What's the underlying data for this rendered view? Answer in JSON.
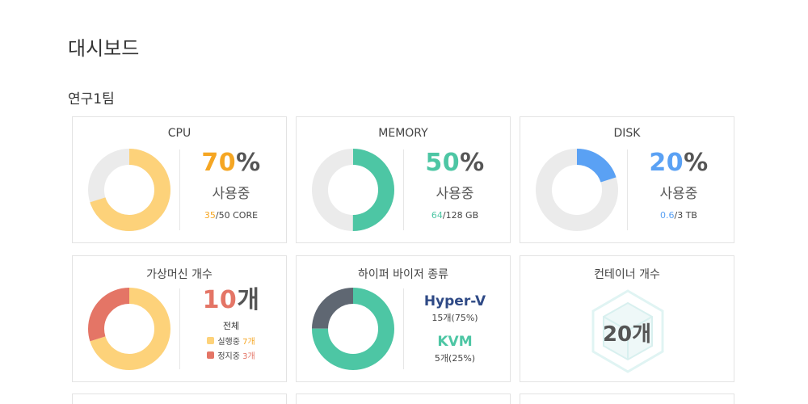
{
  "page_title": "대시보드",
  "section_title": "연구1팀",
  "colors": {
    "cpu": "#f5a623",
    "cpu_ring": "#fdd27a",
    "memory": "#4dc6a4",
    "disk": "#5aa1f4",
    "vm_running": "#fdd27a",
    "vm_stopped": "#e47566",
    "vm_total": "#e47566",
    "hyperv": "#5f6772",
    "kvm": "#4dc6a4",
    "track": "#ebebeb"
  },
  "cpu": {
    "title": "CPU",
    "percent": 70,
    "percent_sign": "%",
    "status": "사용중",
    "used": "35",
    "capacity": "/50 CORE"
  },
  "memory": {
    "title": "MEMORY",
    "percent": 50,
    "percent_sign": "%",
    "status": "사용중",
    "used": "64",
    "capacity": "/128 GB"
  },
  "disk": {
    "title": "DISK",
    "percent": 20,
    "percent_sign": "%",
    "status": "사용중",
    "used": "0.6",
    "capacity": "/3 TB"
  },
  "vm": {
    "title": "가상머신 개수",
    "total": "10",
    "total_unit": "개",
    "total_label": "전체",
    "running_label": "실행중",
    "running_count": "7개",
    "running_value": 7,
    "stopped_label": "정지중",
    "stopped_count": "3개",
    "stopped_value": 3
  },
  "hypervisor": {
    "title": "하이퍼 바이저 종류",
    "hyperv_name": "Hyper-V",
    "hyperv_detail": "15개(75%)",
    "hyperv_value": 15,
    "kvm_name": "KVM",
    "kvm_detail": "5개(25%)",
    "kvm_value": 5
  },
  "containers": {
    "title": "컨테이너 개수",
    "count": "20개"
  }
}
